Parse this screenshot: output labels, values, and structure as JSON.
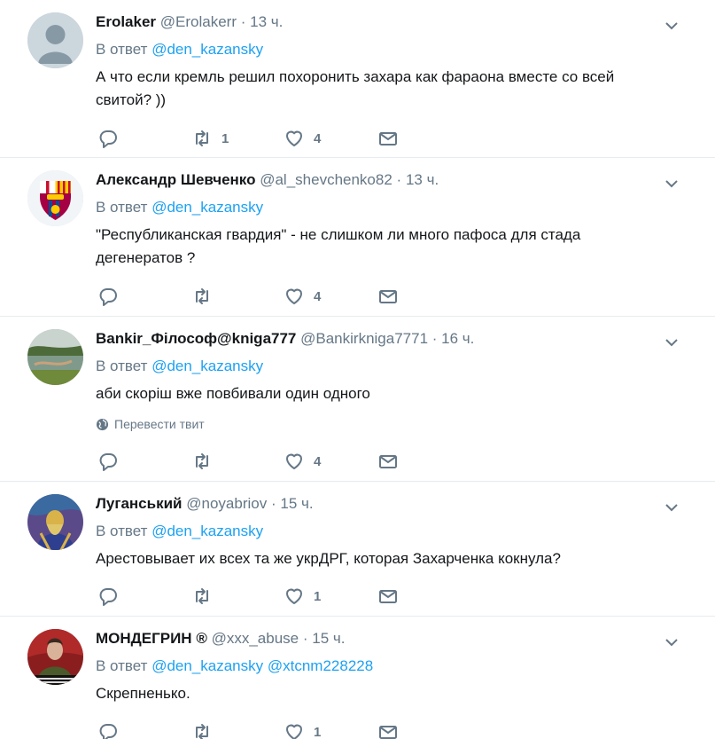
{
  "reply_prefix": "В ответ",
  "translate_label": "Перевести твит",
  "tweets": [
    {
      "name": "Erolaker",
      "handle": "@Erolakerr",
      "time": "13 ч.",
      "reply_to": [
        "@den_kazansky"
      ],
      "text": "А что если кремль решил похоронить захара как фараона вместе со всей свитой? ))",
      "retweets": "1",
      "likes": "4",
      "avatar": "default-avatar"
    },
    {
      "name": "Александр Шевченко",
      "handle": "@al_shevchenko82",
      "time": "13 ч.",
      "reply_to": [
        "@den_kazansky"
      ],
      "text": "\"Республиканская гвардия\" - не слишком ли много пафоса для стада дегенератов ?",
      "retweets": "",
      "likes": "4",
      "avatar": "fcb-crest-avatar"
    },
    {
      "name": "Bankir_Філософ@kniga777",
      "handle": "@Bankirkniga7771",
      "time": "16 ч.",
      "reply_to": [
        "@den_kazansky"
      ],
      "text": "аби скоріш вже повбивали один одного",
      "retweets": "",
      "likes": "4",
      "avatar": "landscape-avatar"
    },
    {
      "name": "Луганський",
      "handle": "@noyabriov",
      "time": "15 ч.",
      "reply_to": [
        "@den_kazansky"
      ],
      "text": "Арестовывает их всех та же укрДРГ, которая Захарченка кокнула?",
      "retweets": "",
      "likes": "1",
      "avatar": "portrait-painting-avatar"
    },
    {
      "name": "МОНДЕГРИН",
      "name_badge": "®",
      "handle": "@xxx_abuse",
      "time": "15 ч.",
      "reply_to": [
        "@den_kazansky",
        "@xtcnm228228"
      ],
      "text": "Скрепненько.",
      "retweets": "",
      "likes": "1",
      "avatar": "person-photo-avatar"
    }
  ],
  "colors": {
    "link": "#1da1f2",
    "muted": "#657786",
    "text": "#14171a",
    "divider": "#e6ecf0"
  }
}
